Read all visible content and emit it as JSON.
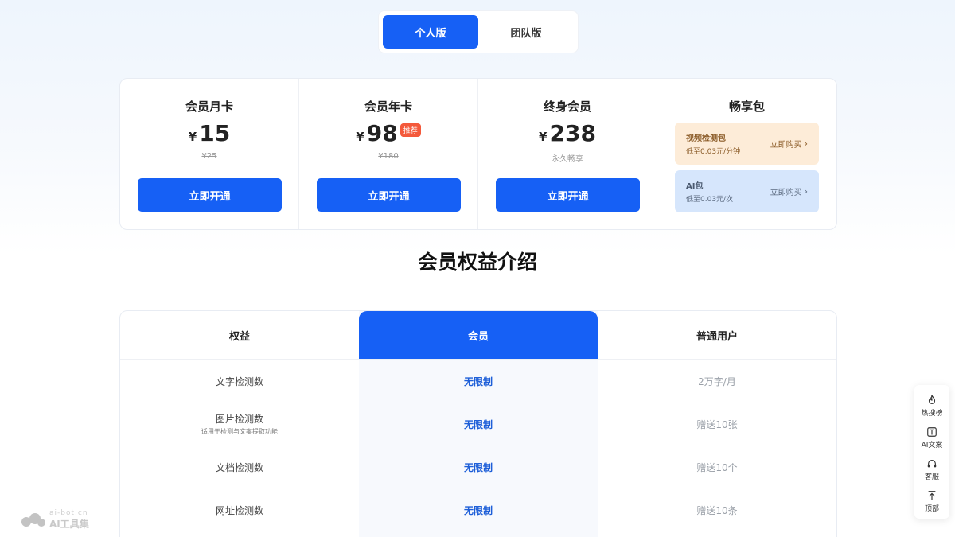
{
  "tabs": [
    {
      "label": "个人版",
      "active": true
    },
    {
      "label": "团队版",
      "active": false
    }
  ],
  "plans": [
    {
      "name": "会员月卡",
      "currency": "¥",
      "price": "15",
      "original": "¥25",
      "cta": "立即开通"
    },
    {
      "name": "会员年卡",
      "currency": "¥",
      "price": "98",
      "badge": "推荐",
      "original": "¥180",
      "cta": "立即开通"
    },
    {
      "name": "终身会员",
      "currency": "¥",
      "price": "238",
      "note": "永久畅享",
      "cta": "立即开通"
    }
  ],
  "packs": {
    "name": "畅享包",
    "items": [
      {
        "title": "视频检测包",
        "sub": "低至0.03元/分钟",
        "link": "立即购买",
        "color": "#fdecd8"
      },
      {
        "title": "AI包",
        "sub": "低至0.03元/次",
        "link": "立即购买",
        "color": "#d6e6fc"
      }
    ]
  },
  "benefits": {
    "title": "会员权益介绍",
    "headers": [
      "权益",
      "会员",
      "普通用户"
    ],
    "rows": [
      {
        "label": "文字检测数",
        "note": "",
        "member": "无限制",
        "free": "2万字/月"
      },
      {
        "label": "图片检测数",
        "note": "适用于检测与文案提取功能",
        "member": "无限制",
        "free": "赠送10张"
      },
      {
        "label": "文档检测数",
        "note": "",
        "member": "无限制",
        "free": "赠送10个"
      },
      {
        "label": "网址检测数",
        "note": "",
        "member": "无限制",
        "free": "赠送10条"
      }
    ]
  },
  "sidebar": {
    "items": [
      {
        "label": "热搜榜",
        "icon": "fire-icon"
      },
      {
        "label": "AI文案",
        "icon": "text-box-icon"
      },
      {
        "label": "客服",
        "icon": "headset-icon"
      },
      {
        "label": "顶部",
        "icon": "arrow-up-icon"
      }
    ]
  },
  "watermark": {
    "url": "ai-bot.cn",
    "name": "AI工具集"
  },
  "colors": {
    "primary": "#1660f5",
    "badge": "#f4593b",
    "member_text": "#1e5fd8"
  }
}
